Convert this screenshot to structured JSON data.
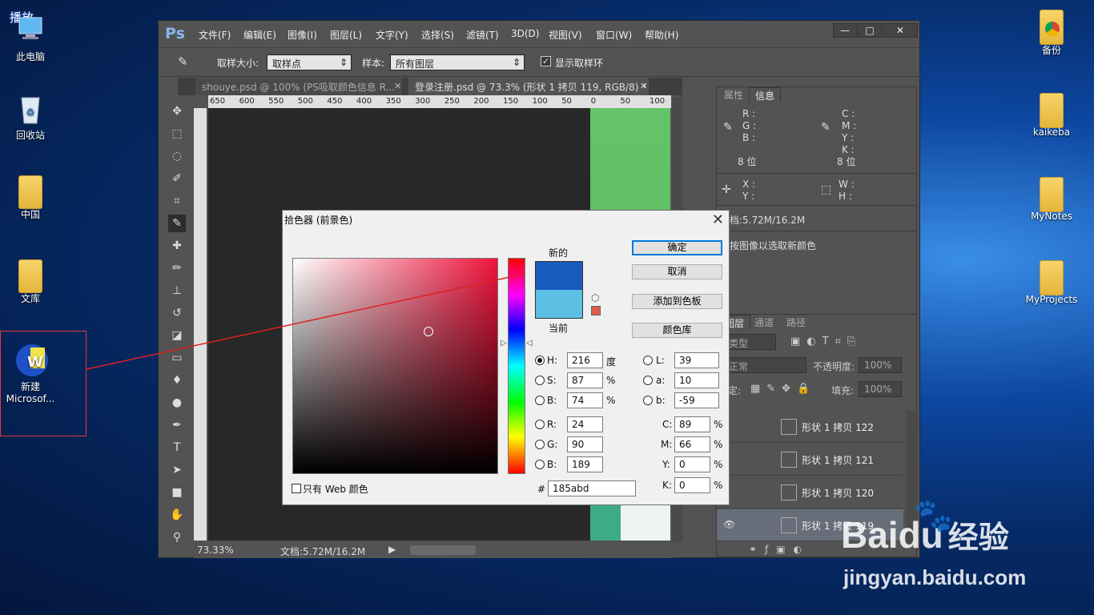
{
  "desktop": {
    "overlay_label": "播放",
    "left_icons": [
      {
        "label": "此电脑",
        "icon": "computer-icon"
      },
      {
        "label": "回收站",
        "icon": "recycle-bin-icon"
      },
      {
        "label": "中国",
        "icon": "folder-icon"
      },
      {
        "label": "文库",
        "icon": "folder-icon"
      },
      {
        "label": "新建\nMicrosof...",
        "label_1": "新建",
        "label_2": "Microsof...",
        "icon": "word-doc-icon"
      }
    ],
    "right_icons": [
      {
        "label": "备份",
        "icon": "chrome-folder-icon"
      },
      {
        "label": "kaikeba",
        "icon": "folder-icon"
      },
      {
        "label": "MyNotes",
        "icon": "folder-icon"
      },
      {
        "label": "MyProjects",
        "icon": "folder-icon"
      }
    ]
  },
  "ps": {
    "logo": "Ps",
    "menu": [
      "文件(F)",
      "编辑(E)",
      "图像(I)",
      "图层(L)",
      "文字(Y)",
      "选择(S)",
      "滤镜(T)",
      "3D(D)",
      "视图(V)",
      "窗口(W)",
      "帮助(H)"
    ],
    "window_buttons": {
      "minimize": "—",
      "maximize": "□",
      "close": "✕"
    },
    "options": {
      "sample_size_label": "取样大小:",
      "sample_size_value": "取样点",
      "sample_label": "样本:",
      "sample_value": "所有图层",
      "show_ring_label": "显示取样环"
    },
    "tabs": [
      {
        "label": "shouye.psd @ 100% (PS吸取颜色信息 R...",
        "active": false
      },
      {
        "label": "登录注册.psd @ 73.3% (形状 1 拷贝 119, RGB/8) *",
        "active": true
      }
    ],
    "ruler_top": [
      "650",
      "600",
      "550",
      "500",
      "450",
      "400",
      "350",
      "300",
      "250",
      "200",
      "150",
      "100",
      "50",
      "0",
      "50",
      "100"
    ],
    "status": {
      "zoom": "73.33%",
      "doc": "文档:5.72M/16.2M"
    }
  },
  "info_panel": {
    "tabs": [
      "属性",
      "信息"
    ],
    "rgb_labels": [
      "R :",
      "G :",
      "B :"
    ],
    "cmyk_labels": [
      "C :",
      "M :",
      "Y :",
      "K :"
    ],
    "bits_left": "8 位",
    "bits_right": "8 位",
    "xy_labels": [
      "X :",
      "Y :"
    ],
    "wh_labels": [
      "W :",
      "H :"
    ],
    "doc": "文档:5.72M/16.2M",
    "hint": "点按图像以选取新颜色"
  },
  "layers_panel": {
    "tabs": [
      "图层",
      "通道",
      "路径"
    ],
    "filter": "类型",
    "blend": "正常",
    "opacity_label": "不透明度:",
    "opacity": "100%",
    "lock_label": "锁定:",
    "fill_label": "填充:",
    "fill": "100%",
    "layers": [
      {
        "name": "形状 1 拷贝 122",
        "selected": false
      },
      {
        "name": "形状 1 拷贝 121",
        "selected": false
      },
      {
        "name": "形状 1 拷贝 120",
        "selected": false
      },
      {
        "name": "形状 1 拷贝 119",
        "selected": true
      }
    ]
  },
  "color_picker": {
    "title": "拾色器 (前景色)",
    "new_label": "新的",
    "current_label": "当前",
    "buttons": {
      "ok": "确定",
      "cancel": "取消",
      "add_swatch": "添加到色板",
      "library": "颜色库"
    },
    "hsb": {
      "H": "216",
      "S": "87",
      "B": "74"
    },
    "rgb": {
      "R": "24",
      "G": "90",
      "B": "189"
    },
    "lab": {
      "L": "39",
      "a": "10",
      "b": "-59"
    },
    "cmyk": {
      "C": "89",
      "M": "66",
      "Y": "0",
      "K": "0"
    },
    "units": {
      "degree": "度",
      "percent": "%"
    },
    "hex": "185abd",
    "web_only_label": "只有 Web 颜色",
    "new_color": "#185abd",
    "current_color": "#5cc0e5"
  },
  "watermark": {
    "brand": "Baidu",
    "suffix": "经验",
    "url": "jingyan.baidu.com"
  }
}
